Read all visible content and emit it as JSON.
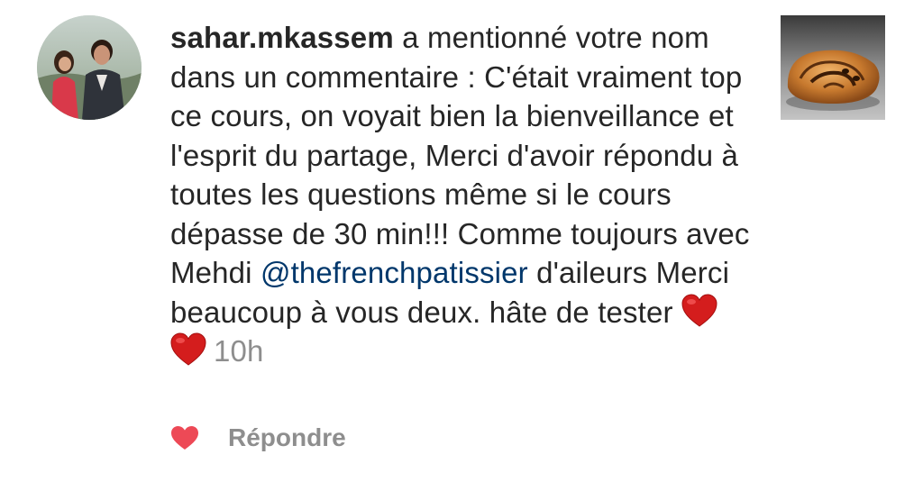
{
  "comment": {
    "username": "sahar.mkassem",
    "text_main": " a mentionné votre nom dans un commentaire : C'était vraiment top ce cours, on voyait bien la bienveillance et l'esprit du partage, Merci d'avoir répondu à toutes les questions même si le cours dépasse de 30 min!!! Comme toujours avec Mehdi ",
    "mention": "@thefrenchpatissier",
    "text_after_mention": " d'aileurs Merci beaucoup à vous deux. hâte de tester ",
    "timestamp": "10h"
  },
  "avatar_icon": "profile-photo-couple",
  "thumbnail_icon": "pastry-thumbnail",
  "actions": {
    "like_icon": "heart-icon",
    "like_color": "#ed4956",
    "reply_label": "Répondre"
  },
  "colors": {
    "text": "#262626",
    "mention": "#00376b",
    "muted": "#8e8e8e",
    "heart": "#ed4956"
  }
}
